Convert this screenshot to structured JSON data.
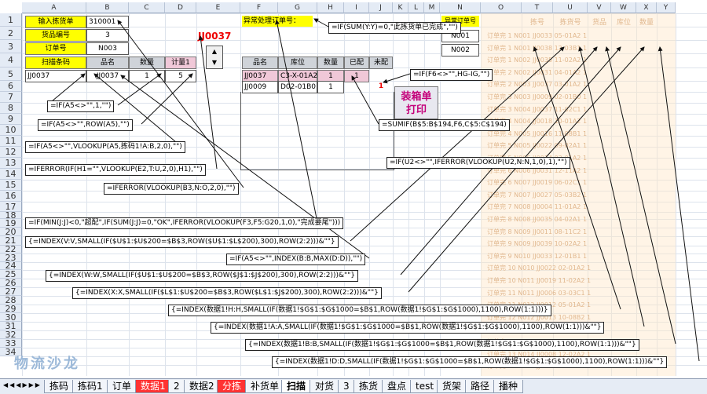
{
  "columns": [
    "A",
    "B",
    "C",
    "D",
    "E",
    "F",
    "G",
    "H",
    "I",
    "J",
    "K",
    "L",
    "M",
    "N",
    "O",
    "T",
    "U",
    "V",
    "W",
    "X",
    "Y"
  ],
  "rows": [
    "1",
    "2",
    "3",
    "4",
    "5",
    "6",
    "7",
    "8",
    "9",
    "10",
    "11",
    "12",
    "13",
    "14",
    "15",
    "16",
    "17",
    "18",
    "19",
    "20",
    "21",
    "22",
    "23",
    "24",
    "25",
    "26",
    "27",
    "28",
    "29",
    "30",
    "31",
    "32",
    "33",
    "34"
  ],
  "cells": {
    "a1": "输入拣货单",
    "b1": "310001",
    "a2": "货品编号",
    "b2": "3",
    "a3": "订单号",
    "b3": "N003",
    "a4": "扫描条码",
    "b4": "品名",
    "c4": "数量",
    "d4": "计量1",
    "a5": "JJ0037",
    "b5": "JJ0037",
    "c5": "1",
    "d5": "5",
    "e2": "JJ0037",
    "f1": "异常处理订单号：",
    "f4": "品名",
    "g4": "库位",
    "h4": "数量",
    "i4": "已配",
    "j4": "未配",
    "f5": "JJ0037",
    "g5": "C3-X-01A2",
    "h5": "1",
    "i5": "1",
    "f6": "JJ0009",
    "g6": "D02-01B0",
    "h6": "1",
    "j6": "1",
    "n1": "异常订单号",
    "n2": "N001",
    "n3": "N002",
    "t1": "拣号",
    "u1": "拣货号",
    "v1": "货品",
    "w1": "库位",
    "x1": "数量"
  },
  "right_faint": [
    "订单完 1 N001 JJ0033 05-01A2 1",
    "订单完 1 N001 JJ0038 12-03B1 1",
    "订单完 1 N002 JJ0035 11-02A2 1",
    "订单完 2 N002 JJ0031 04-01A2 1",
    "订单完 2 N003 JJ0037 03-01A2 1",
    "订单完 3 N003 JJ0009 02-01B0 1",
    "订单完 3 N004 JJ0037 11-02C1 1",
    "订单完 4 N004 JJ0018 10-01A2 1",
    "订单完 4 N005 JJ0016 11-08B1 1",
    "订单完 5 N005 JJ0022 09-02A1 1",
    "订单完 5 N006 JJ0014 03-01A2 1",
    "订单完 6 N006 JJ0031 12-11A2 1",
    "订单完 6 N007 JJ0019 06-02C1 1",
    "订单完 7 N007 JJ0027 05-03B2 1",
    "订单完 7 N008 JJ0004 11-01A2 1",
    "订单完 8 N008 JJ0035 04-02A1 1",
    "订单完 8 N009 JJ0011 08-11C2 1",
    "订单完 9 N009 JJ0039 10-02A2 1",
    "订单完 9 N010 JJ0033 12-01B1 1",
    "订单完 10 N010 JJ0022 02-01A2 1",
    "订单完 10 N011 JJ0019 11-02A2 1",
    "订单完 11 N011 JJ0006 03-03C1 1",
    "订单完 11 N012 JJ0012 05-01A2 1",
    "订单完 12 N012 JJ0013 10-08B2 1",
    "订单完 12 N013 JJ0019 11-02A1 1",
    "订单完 13 N013 JJ0021 04-01A2 1",
    "订单完 13 N014 JJ0008 12-02A2 1",
    "订单完 14 N014 JJ0025 06-11C1 1"
  ],
  "formulas": {
    "f_top": "=IF(SUM(Y:Y)=0,\"此拣货单已完成\",\"\")",
    "f_jk": "=IF(F6<>\"\",HG-IG,\"\")",
    "f_a5": "=IF(A5<>\"\",1,\"\")",
    "f_row": "=IF(A5<>\"\",ROW(A5),\"\")",
    "f_vl1": "=IF(A5<>\"\",VLOOKUP(A5,拣码1!A:B,2,0),\"\")",
    "f_sumif": "=SUMIF(B$5:B$194,F6,C$5:C$194)",
    "f_u2": "=IF(U2<>\"\",IFERROR(VLOOKUP(U2,N:N,1,0),1),\"\")",
    "f_iferr1": "=IFERROR(IF(H1=\"\",VLOOKUP(E2,T:U,2,0),H1),\"\")",
    "f_iferr2": "=IFERROR(VLOOKUP(B3,N:O,2,0),\"\")",
    "f_min": "=IF(MIN(J:J)<0,\"超配\",IF(SUM(J:J)=0,\"OK\",IFERROR(VLOOKUP(F3,F5:G20,1,0),\"完成要尾\")))",
    "f_idx1": "{=INDEX(V:V,SMALL(IF($U$1:$U$200=$B$3,ROW($U$1:$L$200),300),ROW(2:2)))&\"\"}",
    "f_max": "=IF(A5<>\"\",INDEX(B:B,MAX(D:D)),\"\")",
    "f_idx2": "{=INDEX(W:W,SMALL(IF($U$1:$U$200=$B$3,ROW($J$1:$J$200),300),ROW(2:2)))&\"\"}",
    "f_idx3": "{=INDEX(X:X,SMALL(IF($L$1:$U$200=$B$3,ROW($L$1:$J$200),300),ROW(2:2)))&\"\"}",
    "f_idx4": "{=INDEX(数据1!H:H,SMALL(IF(数据1!$G$1:$G$1000=$B$1,ROW(数据1!$G$1:$G$1000),1100),ROW(1:1)))}",
    "f_idx5": "{=INDEX(数据1!A:A,SMALL(IF(数据1!$G$1:$G$1000=$B$1,ROW(数据1!$G$1:$G$1000),1100),ROW(1:1)))&\"\"}",
    "f_idx6": "{=INDEX(数据1!B:B,SMALL(IF(数据1!$G$1:$G$1000=$B$1,ROW(数据1!$G$1:$G$1000),1100),ROW(1:1)))&\"\"}",
    "f_idx7": "{=INDEX(数据1!D:D,SMALL(IF(数据1!$G$1:$G$1000=$B$1,ROW(数据1!$G$1:$G$1000),1100),ROW(1:1)))&\"\"}"
  },
  "buttons": {
    "print": "装箱单\n打印"
  },
  "watermark": "物流沙龙",
  "tabs": [
    "拣码",
    "拣码1",
    "订单",
    "数据1",
    "2",
    "数据2",
    "分拣",
    "补货单",
    "扫描",
    "对货",
    "3",
    "拣货",
    "盘点",
    "test",
    "货架",
    "路径",
    "播种"
  ],
  "active_tab": "扫描",
  "red_tabs": [
    "数据1",
    "分拣"
  ]
}
